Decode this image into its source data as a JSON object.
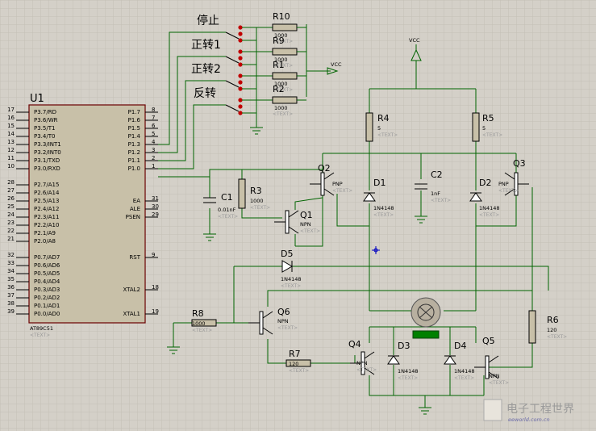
{
  "mcu": {
    "ref": "U1",
    "part": "AT89C51",
    "text": "<TEXT>",
    "left_pins": [
      {
        "num": "17",
        "name": "P3.7/RD"
      },
      {
        "num": "16",
        "name": "P3.6/WR"
      },
      {
        "num": "15",
        "name": "P3.5/T1"
      },
      {
        "num": "14",
        "name": "P3.4/T0"
      },
      {
        "num": "13",
        "name": "P3.3/INT1"
      },
      {
        "num": "12",
        "name": "P3.2/INT0"
      },
      {
        "num": "11",
        "name": "P3.1/TXD"
      },
      {
        "num": "10",
        "name": "P3.0/RXD"
      },
      {
        "num": "28",
        "name": "P2.7/A15"
      },
      {
        "num": "27",
        "name": "P2.6/A14"
      },
      {
        "num": "26",
        "name": "P2.5/A13"
      },
      {
        "num": "25",
        "name": "P2.4/A12"
      },
      {
        "num": "24",
        "name": "P2.3/A11"
      },
      {
        "num": "23",
        "name": "P2.2/A10"
      },
      {
        "num": "22",
        "name": "P2.1/A9"
      },
      {
        "num": "21",
        "name": "P2.0/A8"
      },
      {
        "num": "32",
        "name": "P0.7/AD7"
      },
      {
        "num": "33",
        "name": "P0.6/AD6"
      },
      {
        "num": "34",
        "name": "P0.5/AD5"
      },
      {
        "num": "35",
        "name": "P0.4/AD4"
      },
      {
        "num": "36",
        "name": "P0.3/AD3"
      },
      {
        "num": "37",
        "name": "P0.2/AD2"
      },
      {
        "num": "38",
        "name": "P0.1/AD1"
      },
      {
        "num": "39",
        "name": "P0.0/AD0"
      }
    ],
    "right_pins": [
      {
        "num": "8",
        "name": "P1.7"
      },
      {
        "num": "7",
        "name": "P1.6"
      },
      {
        "num": "6",
        "name": "P1.5"
      },
      {
        "num": "5",
        "name": "P1.4"
      },
      {
        "num": "4",
        "name": "P1.3"
      },
      {
        "num": "3",
        "name": "P1.2"
      },
      {
        "num": "2",
        "name": "P1.1"
      },
      {
        "num": "1",
        "name": "P1.0"
      },
      {
        "num": "31",
        "name": "EA"
      },
      {
        "num": "30",
        "name": "ALE"
      },
      {
        "num": "29",
        "name": "PSEN"
      },
      {
        "num": "9",
        "name": "RST"
      },
      {
        "num": "18",
        "name": "XTAL2"
      },
      {
        "num": "19",
        "name": "XTAL1"
      }
    ]
  },
  "switches": [
    {
      "label": "停止",
      "res": "R10",
      "val": "1000"
    },
    {
      "label": "正转1",
      "res": "R9",
      "val": "1000"
    },
    {
      "label": "正转2",
      "res": "R1",
      "val": "1000"
    },
    {
      "label": "反转",
      "res": "R2",
      "val": "1000"
    }
  ],
  "vcc_label": "VCC",
  "text_tag": "<TEXT>",
  "parts": {
    "r4": {
      "ref": "R4",
      "val": "5"
    },
    "r5": {
      "ref": "R5",
      "val": "5"
    },
    "r3": {
      "ref": "R3",
      "val": "1000"
    },
    "r8": {
      "ref": "R8",
      "val": "1000"
    },
    "r7": {
      "ref": "R7",
      "val": "120"
    },
    "r6": {
      "ref": "R6",
      "val": "120"
    },
    "c1": {
      "ref": "C1",
      "val": "0.01nF"
    },
    "c2": {
      "ref": "C2",
      "val": "1nF"
    },
    "d1": {
      "ref": "D1",
      "val": "1N4148"
    },
    "d2": {
      "ref": "D2",
      "val": "1N4148"
    },
    "d3": {
      "ref": "D3",
      "val": "1N4148"
    },
    "d4": {
      "ref": "D4",
      "val": "1N4148"
    },
    "d5": {
      "ref": "D5",
      "val": "1N4148"
    },
    "q1": {
      "ref": "Q1",
      "type": "NPN"
    },
    "q2": {
      "ref": "Q2",
      "type": "PNP"
    },
    "q3": {
      "ref": "Q3",
      "type": "PNP"
    },
    "q4": {
      "ref": "Q4",
      "type": "NPN"
    },
    "q5": {
      "ref": "Q5",
      "type": "NPN"
    },
    "q6": {
      "ref": "Q6",
      "type": "NPN"
    }
  },
  "watermark": {
    "text": "电子工程世界",
    "url": "eeworld.com.cn"
  },
  "colors": {
    "bg": "#d4d0c8",
    "wire": "#006400",
    "body": "#c8c0a8",
    "switch_red": "#c00000"
  }
}
